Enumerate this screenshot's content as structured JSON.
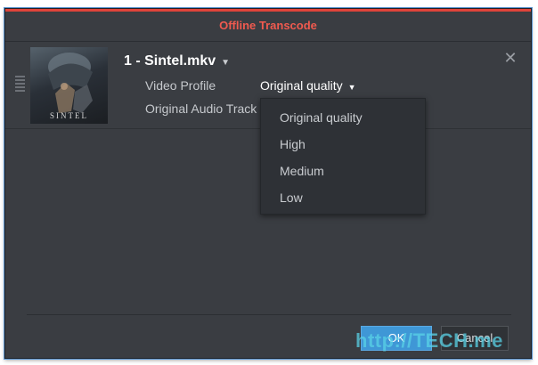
{
  "dialog": {
    "title": "Offline Transcode",
    "accent_color": "#e0443a"
  },
  "item": {
    "title": "1 - Sintel.mkv",
    "poster_text": "SINTEL",
    "video_profile_label": "Video Profile",
    "video_profile_value": "Original quality",
    "audio_track_label": "Original Audio Track"
  },
  "dropdown": {
    "options": [
      "Original quality",
      "High",
      "Medium",
      "Low"
    ]
  },
  "buttons": {
    "ok": "OK",
    "cancel": "Cancel"
  },
  "watermark": "http://TECH.me",
  "icons": {
    "close": "close-icon",
    "chevron": "chevron-down-icon",
    "drag": "drag-handle-icon"
  }
}
